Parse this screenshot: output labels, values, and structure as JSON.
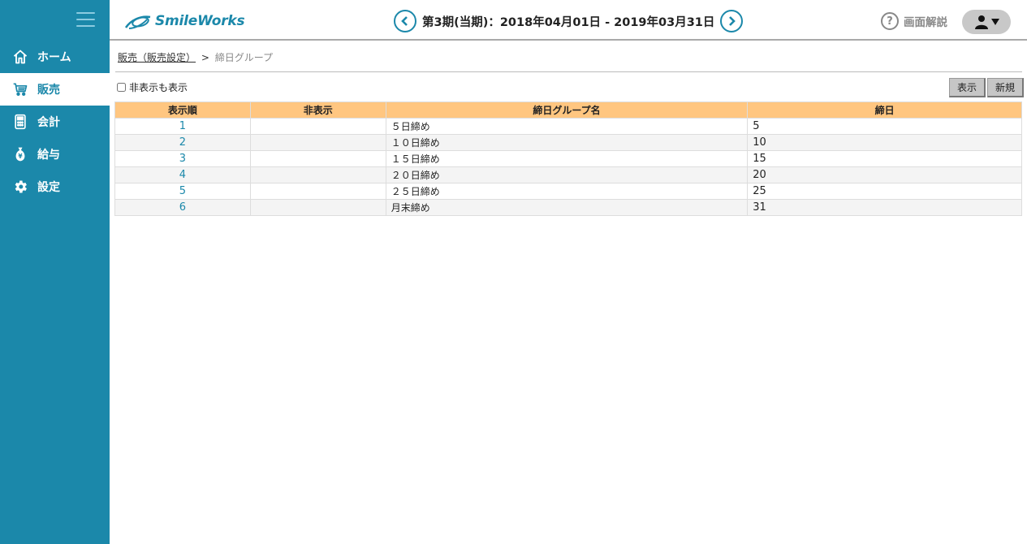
{
  "sidebar": {
    "items": [
      {
        "label": "ホーム",
        "icon": "home-icon"
      },
      {
        "label": "販売",
        "icon": "cart-icon"
      },
      {
        "label": "会計",
        "icon": "calculator-icon"
      },
      {
        "label": "給与",
        "icon": "moneybag-icon"
      },
      {
        "label": "設定",
        "icon": "gear-icon"
      }
    ],
    "active_index": 1
  },
  "header": {
    "logo_text": "SmileWorks",
    "period": "第3期(当期)：2018年04月01日 - 2019年03月31日",
    "help_label": "画面解説",
    "help_symbol": "?"
  },
  "breadcrumb": {
    "parent": "販売（販売設定）",
    "separator": ">",
    "current": "締日グループ"
  },
  "toolbar": {
    "show_hidden_label": "非表示も表示",
    "display_button": "表示",
    "new_button": "新規"
  },
  "table": {
    "headers": [
      "表示順",
      "非表示",
      "締日グループ名",
      "締日"
    ],
    "rows": [
      {
        "order": "1",
        "hidden": "",
        "name": "５日締め",
        "day": "5"
      },
      {
        "order": "2",
        "hidden": "",
        "name": "１０日締め",
        "day": "10"
      },
      {
        "order": "3",
        "hidden": "",
        "name": "１５日締め",
        "day": "15"
      },
      {
        "order": "4",
        "hidden": "",
        "name": "２０日締め",
        "day": "20"
      },
      {
        "order": "5",
        "hidden": "",
        "name": "２５日締め",
        "day": "25"
      },
      {
        "order": "6",
        "hidden": "",
        "name": "月末締め",
        "day": "31"
      }
    ]
  },
  "colors": {
    "brand": "#1b88aa",
    "table_header": "#ffc680"
  }
}
